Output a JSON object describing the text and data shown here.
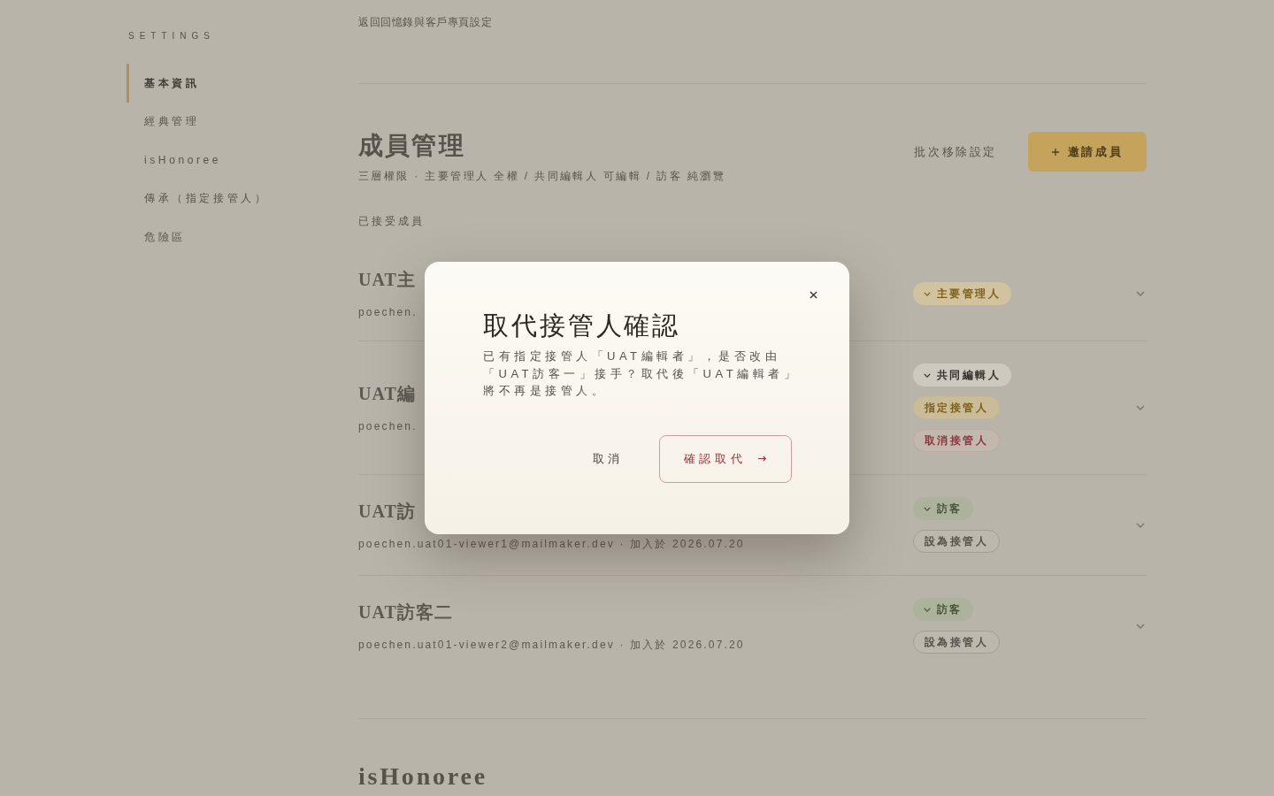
{
  "sidebar": {
    "heading": "SETTINGS",
    "items": [
      {
        "label": "基本資訊",
        "selected": true
      },
      {
        "label": "經典管理",
        "selected": false
      },
      {
        "label": "isHonoree",
        "selected": false
      },
      {
        "label": "傳承（指定接管人）",
        "selected": false
      },
      {
        "label": "危險區",
        "selected": false
      }
    ]
  },
  "header": {
    "back_link": "返回回憶錄與客戶專頁設定"
  },
  "members": {
    "title": "成員管理",
    "subtitle": "三層權限 · 主要管理人 全權 / 共同編輯人 可編輯 / 訪客 純瀏覽",
    "secondary_action": "批次移除設定",
    "primary_action": "邀請成員",
    "list_label": "已接受成員",
    "rows": [
      {
        "name": "UAT主",
        "detail": "poechen.",
        "role": {
          "kind": "owner",
          "label": "主要管理人"
        }
      },
      {
        "name": "UAT編",
        "detail": "poechen.",
        "role": {
          "kind": "editor",
          "label": "共同編輯人"
        },
        "actions": [
          {
            "kind": "assigned",
            "label": "指定接管人"
          },
          {
            "kind": "revoke",
            "label": "取消接管人"
          }
        ]
      },
      {
        "name": "UAT訪",
        "detail": "poechen.uat01-viewer1@mailmaker.dev · 加入於 2026.07.20",
        "role": {
          "kind": "viewer",
          "label": "訪客"
        },
        "actions": [
          {
            "kind": "assign",
            "label": "設為接管人"
          }
        ]
      },
      {
        "name": "UAT訪客二",
        "detail": "poechen.uat01-viewer2@mailmaker.dev · 加入於 2026.07.20",
        "role": {
          "kind": "viewer",
          "label": "訪客"
        },
        "actions": [
          {
            "kind": "assign",
            "label": "設為接管人"
          }
        ]
      }
    ]
  },
  "next_section": {
    "title": "isHonoree"
  },
  "dialog": {
    "title": "取代接管人確認",
    "message": "已有指定接管人「UAT編輯者」，是否改由「UAT訪客一」接手？取代後「UAT編輯者」將不再是接管人。",
    "cancel": "取消",
    "confirm": "確認取代"
  }
}
